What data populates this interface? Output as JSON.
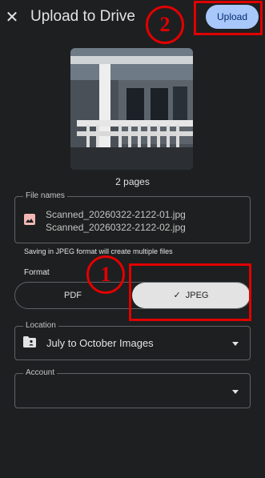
{
  "header": {
    "title": "Upload to Drive",
    "close_glyph": "✕",
    "upload_label": "Upload"
  },
  "annotations": {
    "marker_1": "1",
    "marker_2": "2",
    "color": "#e10000"
  },
  "preview": {
    "pages_label": "2 pages"
  },
  "files": {
    "label": "File names",
    "icon": "image-icon",
    "names": [
      "Scanned_20260322-2122-01.jpg",
      "Scanned_20260322-2122-02.jpg"
    ]
  },
  "format": {
    "note": "Saving in JPEG format will create multiple files",
    "label": "Format",
    "options": [
      "PDF",
      "JPEG"
    ],
    "selected": "JPEG",
    "check_glyph": "✓"
  },
  "location": {
    "label": "Location",
    "value": "July to October Images",
    "icon": "shared-folder-icon"
  },
  "account": {
    "label": "Account",
    "value": ""
  },
  "colors": {
    "background": "#1e1f20",
    "primary_button": "#a8c7fa",
    "file_icon": "#f2b8b5"
  }
}
